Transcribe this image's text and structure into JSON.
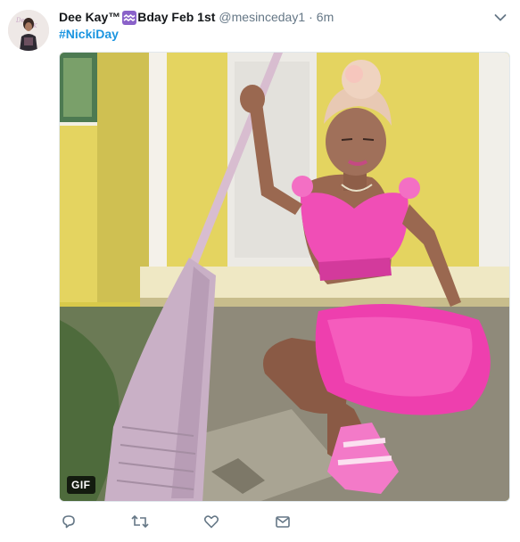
{
  "tweet": {
    "author": {
      "display_name": "Dee Kay™",
      "display_name_suffix": "Bday Feb 1st",
      "emoji_icon": "aquarius-icon",
      "username": "@mesinceday1",
      "separator": "·",
      "time": "6m"
    },
    "text": "#NickiDay",
    "media": {
      "badge": "GIF",
      "description_icon": "animated-gif"
    },
    "actions": [
      {
        "name": "reply-icon"
      },
      {
        "name": "retweet-icon"
      },
      {
        "name": "like-icon"
      },
      {
        "name": "direct-message-icon"
      }
    ]
  },
  "colors": {
    "hashtag": "#1b95e0",
    "secondary_text": "#657786",
    "icon_gray": "#657786",
    "aquarius_bg": "#8a62c9"
  }
}
